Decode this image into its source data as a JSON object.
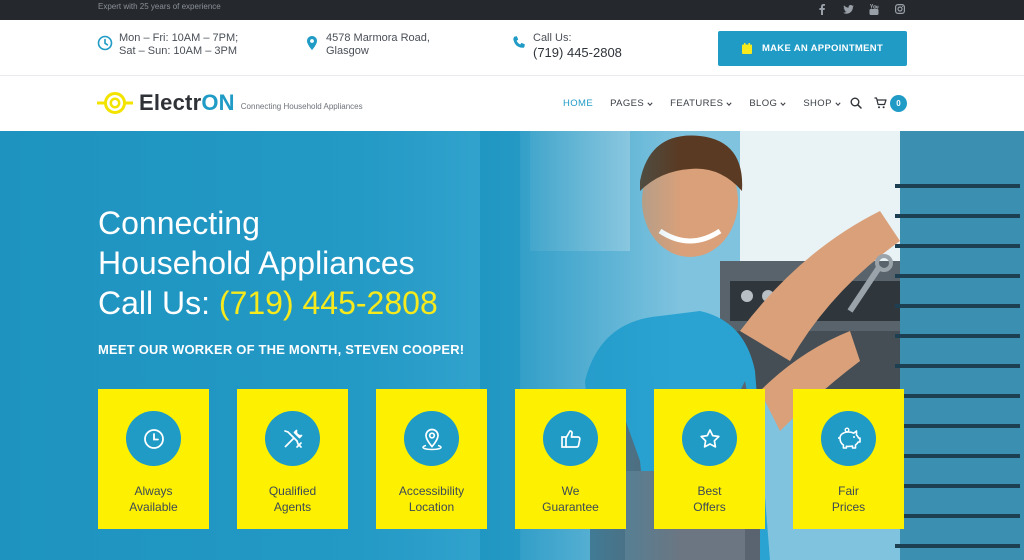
{
  "topbar": {
    "tagline": "Expert with 25 years of experience",
    "social": [
      "facebook-icon",
      "twitter-icon",
      "youtube-icon",
      "instagram-icon"
    ]
  },
  "info": {
    "hours_line1": "Mon – Fri: 10AM – 7PM;",
    "hours_line2": "Sat – Sun: 10AM – 3PM",
    "address_line1": "4578 Marmora Road,",
    "address_line2": "Glasgow",
    "call_label": "Call Us:",
    "call_number": "(719) 445-2808",
    "appointment_label": "MAKE AN APPOINTMENT"
  },
  "logo": {
    "name_part1": "Electr",
    "name_part2": "ON",
    "tagline": "Connecting Household Appliances"
  },
  "nav": {
    "items": [
      {
        "label": "HOME",
        "active": true
      },
      {
        "label": "PAGES"
      },
      {
        "label": "FEATURES"
      },
      {
        "label": "BLOG"
      },
      {
        "label": "SHOP"
      }
    ],
    "cart_count": "0"
  },
  "hero": {
    "title_line1": "Connecting",
    "title_line2": "Household Appliances",
    "call_prefix": "Call Us: ",
    "call_number": "(719) 445-2808",
    "subtitle": "MEET OUR WORKER OF THE MONTH, STEVEN COOPER!"
  },
  "features": [
    {
      "label": "Always\nAvailable",
      "icon": "clock-icon"
    },
    {
      "label": "Qualified\nAgents",
      "icon": "tools-icon"
    },
    {
      "label": "Accessibility\nLocation",
      "icon": "location-icon"
    },
    {
      "label": "We\nGuarantee",
      "icon": "thumbs-up-icon"
    },
    {
      "label": "Best\nOffers",
      "icon": "star-icon"
    },
    {
      "label": "Fair\nPrices",
      "icon": "piggy-bank-icon"
    }
  ],
  "colors": {
    "accent": "#1f9bc6",
    "yellow": "#fdf000",
    "phone_yellow": "#f6ea1d",
    "dark": "#25292e"
  }
}
